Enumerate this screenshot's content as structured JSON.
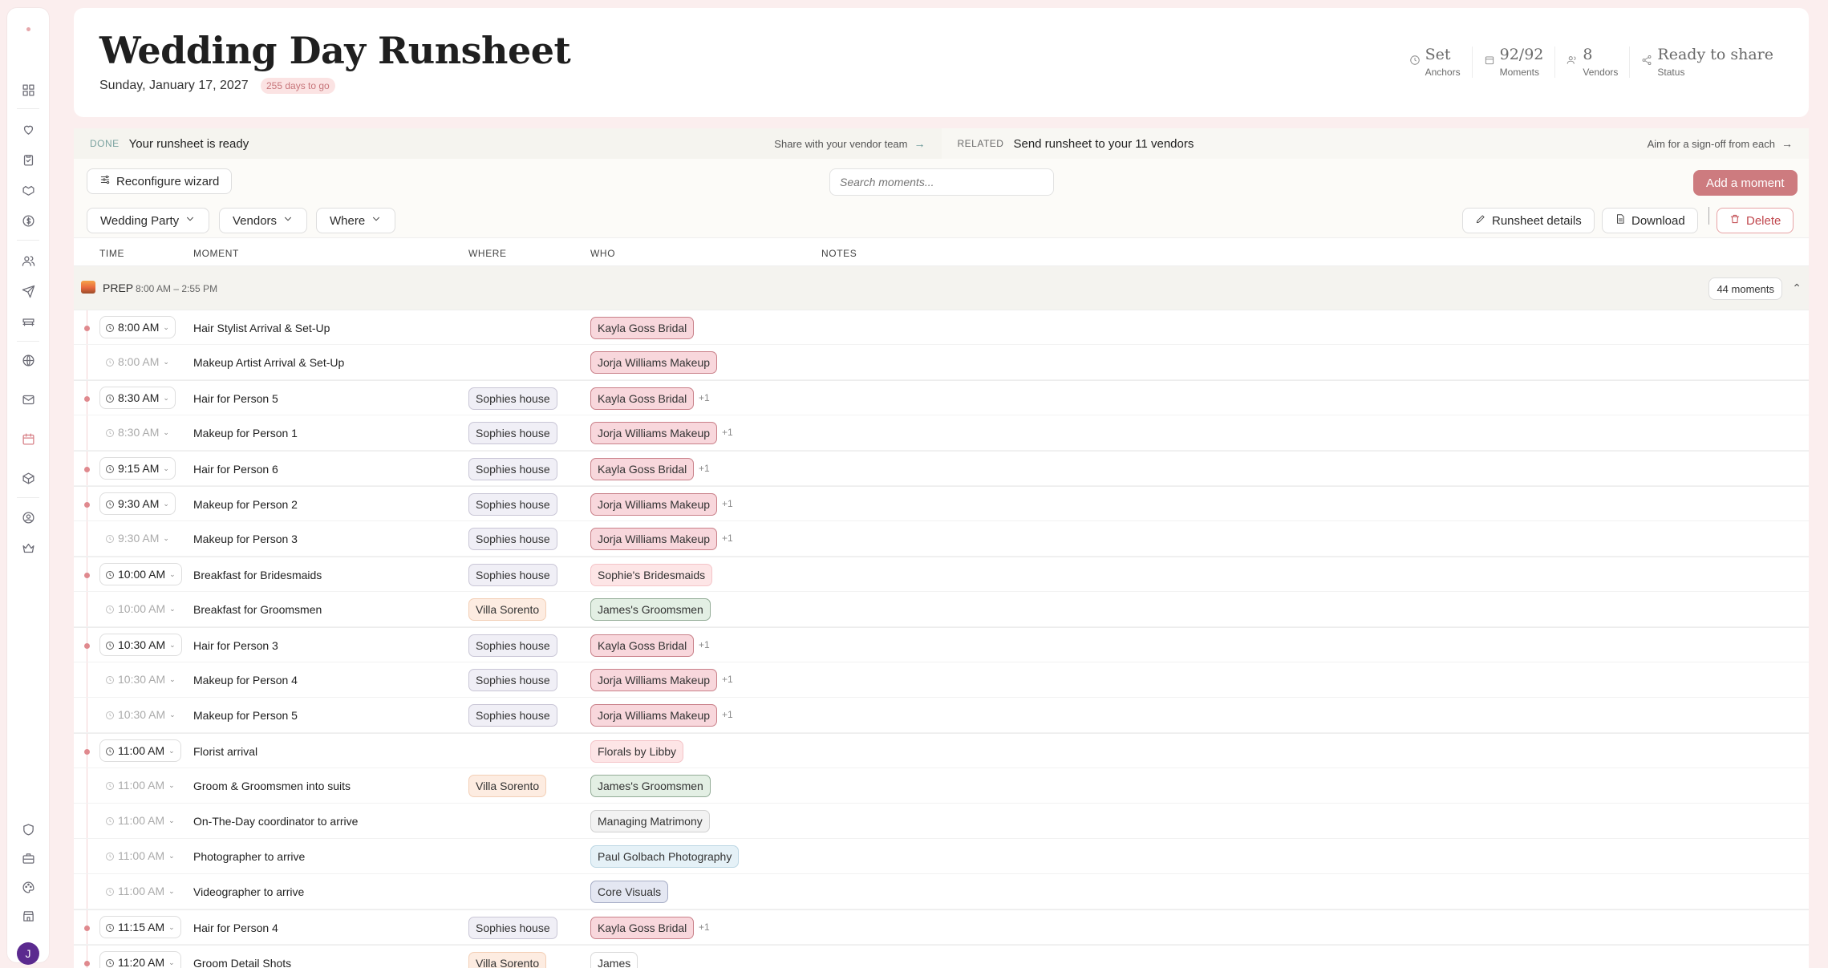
{
  "page": {
    "title": "Wedding Day Runsheet",
    "date": "Sunday, January 17, 2027",
    "days_to_go": "255 days to go"
  },
  "stats": [
    {
      "value": "Set",
      "label": "Anchors",
      "icon": "clock-icon"
    },
    {
      "value": "92/92",
      "label": "Moments",
      "icon": "calendar-icon"
    },
    {
      "value": "8",
      "label": "Vendors",
      "icon": "users-icon"
    },
    {
      "value": "Ready to share",
      "label": "Status",
      "icon": "share-icon"
    }
  ],
  "banner": {
    "done_tag": "DONE",
    "done_text": "Your runsheet is ready",
    "done_link": "Share with your vendor team",
    "related_tag": "RELATED",
    "related_text": "Send runsheet to your 11 vendors",
    "related_link": "Aim for a sign-off from each",
    "arrow": "→"
  },
  "toolbar": {
    "reconfigure": "Reconfigure wizard",
    "search_placeholder": "Search moments...",
    "add_moment": "Add a moment",
    "filters": [
      "Wedding Party",
      "Vendors",
      "Where"
    ],
    "runsheet_details": "Runsheet details",
    "download": "Download",
    "delete": "Delete"
  },
  "table": {
    "headers": {
      "time": "TIME",
      "moment": "MOMENT",
      "where": "WHERE",
      "who": "WHO",
      "notes": "NOTES"
    },
    "group": {
      "name": "PREP",
      "time_range": "8:00 AM – 2:55 PM",
      "count": "44 moments"
    },
    "rows": [
      {
        "time": "8:00 AM",
        "moment": "Hair Stylist Arrival & Set-Up",
        "where": "",
        "where_type": "",
        "who": "Kayla Goss Bridal",
        "who_type": "pink",
        "extra": "",
        "anchor": true
      },
      {
        "time": "8:00 AM",
        "moment": "Makeup Artist Arrival & Set-Up",
        "where": "",
        "where_type": "",
        "who": "Jorja Williams Makeup",
        "who_type": "pink",
        "extra": "",
        "anchor": false
      },
      {
        "time": "8:30 AM",
        "moment": "Hair for Person 5",
        "where": "Sophies house",
        "where_type": "house",
        "who": "Kayla Goss Bridal",
        "who_type": "pink",
        "extra": "+1",
        "anchor": true
      },
      {
        "time": "8:30 AM",
        "moment": "Makeup for Person 1",
        "where": "Sophies house",
        "where_type": "house",
        "who": "Jorja Williams Makeup",
        "who_type": "pink",
        "extra": "+1",
        "anchor": false
      },
      {
        "time": "9:15 AM",
        "moment": "Hair for Person 6",
        "where": "Sophies house",
        "where_type": "house",
        "who": "Kayla Goss Bridal",
        "who_type": "pink",
        "extra": "+1",
        "anchor": true
      },
      {
        "time": "9:30 AM",
        "moment": "Makeup for Person 2",
        "where": "Sophies house",
        "where_type": "house",
        "who": "Jorja Williams Makeup",
        "who_type": "pink",
        "extra": "+1",
        "anchor": true
      },
      {
        "time": "9:30 AM",
        "moment": "Makeup for Person 3",
        "where": "Sophies house",
        "where_type": "house",
        "who": "Jorja Williams Makeup",
        "who_type": "pink",
        "extra": "+1",
        "anchor": false
      },
      {
        "time": "10:00 AM",
        "moment": "Breakfast for Bridesmaids",
        "where": "Sophies house",
        "where_type": "house",
        "who": "Sophie's Bridesmaids",
        "who_type": "peach",
        "extra": "",
        "anchor": true
      },
      {
        "time": "10:00 AM",
        "moment": "Breakfast for Groomsmen",
        "where": "Villa Sorento",
        "where_type": "villa",
        "who": "James's Groomsmen",
        "who_type": "green",
        "extra": "",
        "anchor": false
      },
      {
        "time": "10:30 AM",
        "moment": "Hair for Person 3",
        "where": "Sophies house",
        "where_type": "house",
        "who": "Kayla Goss Bridal",
        "who_type": "pink",
        "extra": "+1",
        "anchor": true
      },
      {
        "time": "10:30 AM",
        "moment": "Makeup for Person 4",
        "where": "Sophies house",
        "where_type": "house",
        "who": "Jorja Williams Makeup",
        "who_type": "pink",
        "extra": "+1",
        "anchor": false
      },
      {
        "time": "10:30 AM",
        "moment": "Makeup for Person 5",
        "where": "Sophies house",
        "where_type": "house",
        "who": "Jorja Williams Makeup",
        "who_type": "pink",
        "extra": "+1",
        "anchor": false
      },
      {
        "time": "11:00 AM",
        "moment": "Florist arrival",
        "where": "",
        "where_type": "",
        "who": "Florals by Libby",
        "who_type": "peach",
        "extra": "",
        "anchor": true
      },
      {
        "time": "11:00 AM",
        "moment": "Groom & Groomsmen into suits",
        "where": "Villa Sorento",
        "where_type": "villa",
        "who": "James's Groomsmen",
        "who_type": "green",
        "extra": "",
        "anchor": false
      },
      {
        "time": "11:00 AM",
        "moment": "On-The-Day coordinator to arrive",
        "where": "",
        "where_type": "",
        "who": "Managing Matrimony",
        "who_type": "gray",
        "extra": "",
        "anchor": false
      },
      {
        "time": "11:00 AM",
        "moment": "Photographer to arrive",
        "where": "",
        "where_type": "",
        "who": "Paul Golbach Photography",
        "who_type": "blue",
        "extra": "",
        "anchor": false
      },
      {
        "time": "11:00 AM",
        "moment": "Videographer to arrive",
        "where": "",
        "where_type": "",
        "who": "Core Visuals",
        "who_type": "lav",
        "extra": "",
        "anchor": false
      },
      {
        "time": "11:15 AM",
        "moment": "Hair for Person 4",
        "where": "Sophies house",
        "where_type": "house",
        "who": "Kayla Goss Bridal",
        "who_type": "pink",
        "extra": "+1",
        "anchor": true
      },
      {
        "time": "11:20 AM",
        "moment": "Groom Detail Shots",
        "where": "Villa Sorento",
        "where_type": "villa",
        "who": "James",
        "who_type": "plain",
        "extra": "",
        "anchor": true
      }
    ]
  },
  "user": {
    "initial": "J"
  },
  "colors": {
    "accent": "#cd7b7f",
    "brand_bg": "#fbeeee",
    "avatar": "#5b2a8f"
  }
}
